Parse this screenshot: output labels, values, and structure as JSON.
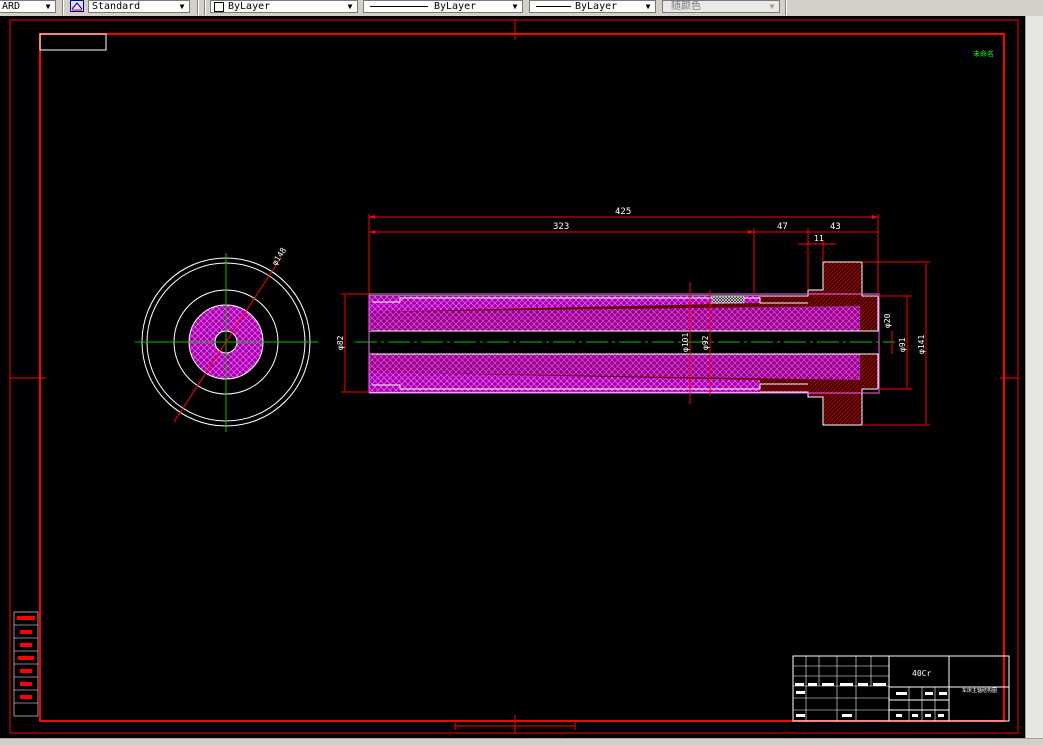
{
  "toolbar": {
    "text_style_partial": "ARD",
    "dim_style": "Standard",
    "layer_combo": "ByLayer",
    "linetype_combo": "ByLayer",
    "lineweight_combo": "ByLayer",
    "plotstyle_combo": "随颜色"
  },
  "drawing": {
    "dim_length_total": "425",
    "dim_length_323": "323",
    "dim_length_47": "47",
    "dim_length_43": "43",
    "dim_length_11": "11",
    "dia_82": "φ82",
    "dia_101": "φ101",
    "dia_92": "φ92",
    "dia_20": "φ20",
    "dia_91": "φ91",
    "dia_141": "φ141",
    "dia_148": "φ148",
    "corner_label": "未命名"
  },
  "title_block": {
    "material": "40Cr",
    "part_name": "车床主轴结构图"
  },
  "colors": {
    "frame_red": "#ff0000",
    "hatch_magenta": "#c020c0",
    "centerline_green": "#00c000",
    "outline_white": "#ffffff",
    "background": "#000000"
  }
}
